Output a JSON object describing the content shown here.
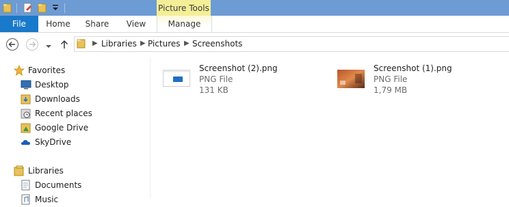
{
  "ribbon": {
    "context_group": "Picture Tools",
    "tabs": [
      "File",
      "Home",
      "Share",
      "View",
      "Manage"
    ]
  },
  "address": {
    "crumbs": [
      "Libraries",
      "Pictures",
      "Screenshots"
    ]
  },
  "nav": {
    "favorites_header": "Favorites",
    "favorites": [
      "Desktop",
      "Downloads",
      "Recent places",
      "Google Drive",
      "SkyDrive"
    ],
    "libraries_header": "Libraries",
    "libraries": [
      "Documents",
      "Music"
    ]
  },
  "files": [
    {
      "name": "Screenshot (2).png",
      "type": "PNG File",
      "size": "131 KB"
    },
    {
      "name": "Screenshot (1).png",
      "type": "PNG File",
      "size": "1,79 MB"
    }
  ],
  "colors": {
    "titlebar": "#6d9bd3",
    "file_tab": "#1979ca",
    "context_tab": "#f4ee97"
  }
}
